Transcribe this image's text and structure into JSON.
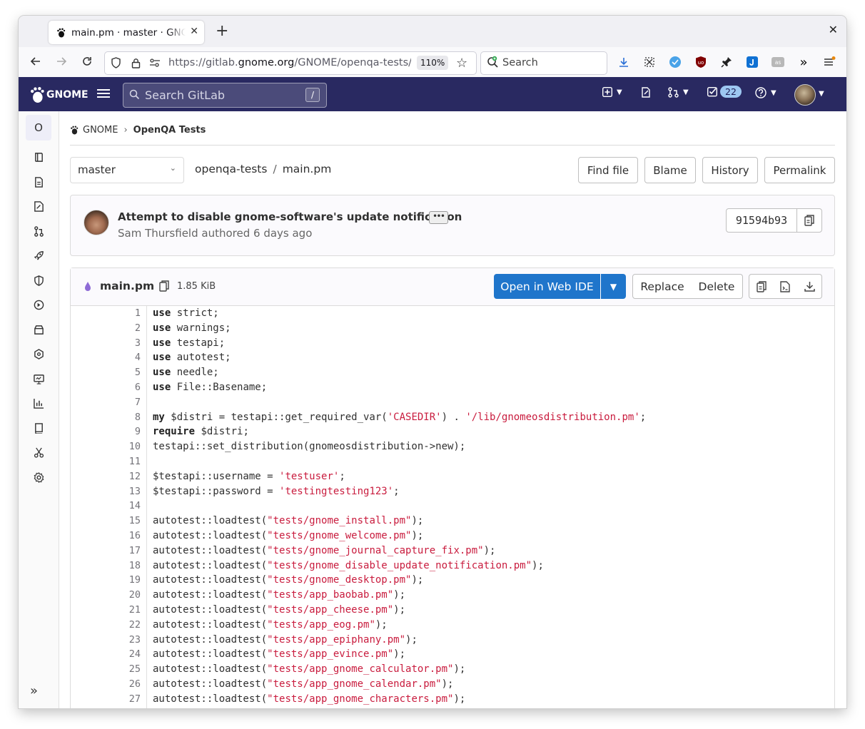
{
  "browser": {
    "tab_title": "main.pm · master · GNOME / OpenQA Tests · GitLab",
    "tab_close": "✕",
    "new_tab": "+",
    "window_close": "✕",
    "url_prefix": "https://gitlab.",
    "url_domain": "gnome.org",
    "url_path": "/GNOME/openqa-tests/-",
    "zoom": "110%",
    "search_placeholder": "Search"
  },
  "gitlab_header": {
    "logo_text": "GNOME",
    "search_placeholder": "Search GitLab",
    "search_shortcut": "/",
    "todo_count": "22"
  },
  "sidebar": {
    "project_initial": "O"
  },
  "breadcrumb": {
    "group": "GNOME",
    "project": "OpenQA Tests"
  },
  "file_nav": {
    "branch": "master",
    "repo": "openqa-tests",
    "separator": "/",
    "file": "main.pm",
    "buttons": [
      "Find file",
      "Blame",
      "History",
      "Permalink"
    ]
  },
  "commit": {
    "message": "Attempt to disable gnome-software's update notification",
    "more": "•••",
    "author_line": "Sam Thursfield authored 6 days ago",
    "sha": "91594b93"
  },
  "file_header": {
    "name": "main.pm",
    "size": "1.85 KiB",
    "open_web_ide": "Open in Web IDE",
    "replace": "Replace",
    "delete": "Delete"
  },
  "code": {
    "lines": [
      {
        "n": "1",
        "parts": [
          [
            "kw",
            "use"
          ],
          [
            "",
            "  strict;"
          ]
        ]
      },
      {
        "n": "2",
        "parts": [
          [
            "kw",
            "use"
          ],
          [
            "",
            " warnings;"
          ]
        ]
      },
      {
        "n": "3",
        "parts": [
          [
            "kw",
            "use"
          ],
          [
            "",
            " testapi;"
          ]
        ]
      },
      {
        "n": "4",
        "parts": [
          [
            "kw",
            "use"
          ],
          [
            "",
            " autotest;"
          ]
        ]
      },
      {
        "n": "5",
        "parts": [
          [
            "kw",
            "use"
          ],
          [
            "",
            " needle;"
          ]
        ]
      },
      {
        "n": "6",
        "parts": [
          [
            "kw",
            "use"
          ],
          [
            "",
            " File::Basename;"
          ]
        ]
      },
      {
        "n": "7",
        "parts": []
      },
      {
        "n": "8",
        "parts": [
          [
            "kw",
            "my"
          ],
          [
            "",
            " $distri = testapi::get_required_var("
          ],
          [
            "str",
            "'CASEDIR'"
          ],
          [
            "",
            ") . "
          ],
          [
            "str",
            "'/lib/gnomeosdistribution.pm'"
          ],
          [
            "",
            ";"
          ]
        ]
      },
      {
        "n": "9",
        "parts": [
          [
            "kw",
            "require"
          ],
          [
            "",
            " $distri;"
          ]
        ]
      },
      {
        "n": "10",
        "parts": [
          [
            "",
            "testapi::set_distribution(gnomeosdistribution->new);"
          ]
        ]
      },
      {
        "n": "11",
        "parts": []
      },
      {
        "n": "12",
        "parts": [
          [
            "",
            "$testapi::username = "
          ],
          [
            "str",
            "'testuser'"
          ],
          [
            "",
            ";"
          ]
        ]
      },
      {
        "n": "13",
        "parts": [
          [
            "",
            "$testapi::password = "
          ],
          [
            "str",
            "'testingtesting123'"
          ],
          [
            "",
            ";"
          ]
        ]
      },
      {
        "n": "14",
        "parts": []
      },
      {
        "n": "15",
        "parts": [
          [
            "",
            "autotest::loadtest("
          ],
          [
            "str",
            "\"tests/gnome_install.pm\""
          ],
          [
            "",
            ");"
          ]
        ]
      },
      {
        "n": "16",
        "parts": [
          [
            "",
            "autotest::loadtest("
          ],
          [
            "str",
            "\"tests/gnome_welcome.pm\""
          ],
          [
            "",
            ");"
          ]
        ]
      },
      {
        "n": "17",
        "parts": [
          [
            "",
            "autotest::loadtest("
          ],
          [
            "str",
            "\"tests/gnome_journal_capture_fix.pm\""
          ],
          [
            "",
            ");"
          ]
        ]
      },
      {
        "n": "18",
        "parts": [
          [
            "",
            "autotest::loadtest("
          ],
          [
            "str",
            "\"tests/gnome_disable_update_notification.pm\""
          ],
          [
            "",
            ");"
          ]
        ]
      },
      {
        "n": "19",
        "parts": [
          [
            "",
            "autotest::loadtest("
          ],
          [
            "str",
            "\"tests/gnome_desktop.pm\""
          ],
          [
            "",
            ");"
          ]
        ]
      },
      {
        "n": "20",
        "parts": [
          [
            "",
            "autotest::loadtest("
          ],
          [
            "str",
            "\"tests/app_baobab.pm\""
          ],
          [
            "",
            ");"
          ]
        ]
      },
      {
        "n": "21",
        "parts": [
          [
            "",
            "autotest::loadtest("
          ],
          [
            "str",
            "\"tests/app_cheese.pm\""
          ],
          [
            "",
            ");"
          ]
        ]
      },
      {
        "n": "22",
        "parts": [
          [
            "",
            "autotest::loadtest("
          ],
          [
            "str",
            "\"tests/app_eog.pm\""
          ],
          [
            "",
            ");"
          ]
        ]
      },
      {
        "n": "23",
        "parts": [
          [
            "",
            "autotest::loadtest("
          ],
          [
            "str",
            "\"tests/app_epiphany.pm\""
          ],
          [
            "",
            ");"
          ]
        ]
      },
      {
        "n": "24",
        "parts": [
          [
            "",
            "autotest::loadtest("
          ],
          [
            "str",
            "\"tests/app_evince.pm\""
          ],
          [
            "",
            ");"
          ]
        ]
      },
      {
        "n": "25",
        "parts": [
          [
            "",
            "autotest::loadtest("
          ],
          [
            "str",
            "\"tests/app_gnome_calculator.pm\""
          ],
          [
            "",
            ");"
          ]
        ]
      },
      {
        "n": "26",
        "parts": [
          [
            "",
            "autotest::loadtest("
          ],
          [
            "str",
            "\"tests/app_gnome_calendar.pm\""
          ],
          [
            "",
            ");"
          ]
        ]
      },
      {
        "n": "27",
        "parts": [
          [
            "",
            "autotest::loadtest("
          ],
          [
            "str",
            "\"tests/app_gnome_characters.pm\""
          ],
          [
            "",
            ");"
          ]
        ]
      }
    ]
  },
  "colors": {
    "header_bg": "#292961",
    "primary_button": "#1f75cb",
    "string": "#c91c3e"
  }
}
